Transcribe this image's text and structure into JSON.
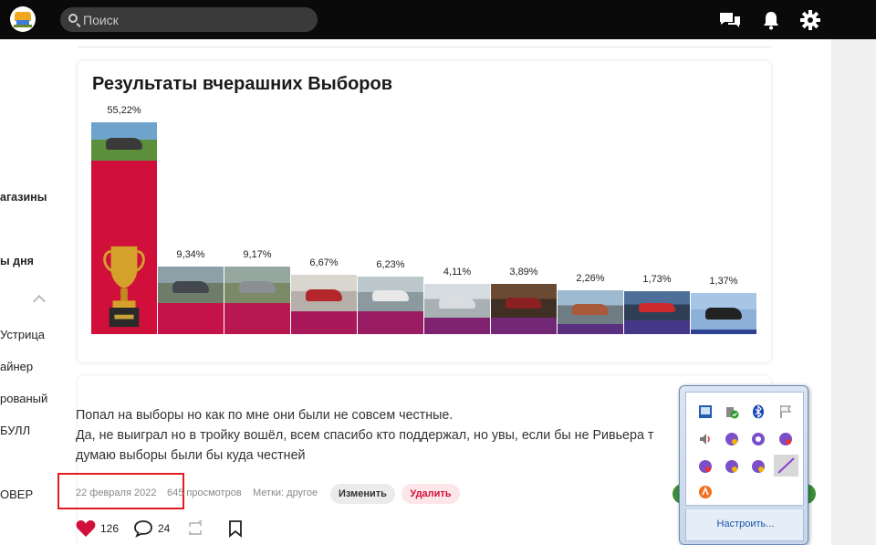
{
  "header": {
    "search_placeholder": "Поиск"
  },
  "sidebar": {
    "items": [
      "агазины",
      "ы дня",
      "Устрица",
      "айнер",
      "рованый",
      "БУЛЛ",
      "ОВЕР"
    ]
  },
  "results": {
    "title": "Результаты вчерашних Выборов",
    "bars": [
      {
        "pct": "55,22%",
        "value": 55.22,
        "color": "#d0103a"
      },
      {
        "pct": "9,34%",
        "value": 9.34,
        "color": "#c4134a"
      },
      {
        "pct": "9,17%",
        "value": 9.17,
        "color": "#b8174f"
      },
      {
        "pct": "6,67%",
        "value": 6.67,
        "color": "#a9195a"
      },
      {
        "pct": "6,23%",
        "value": 6.23,
        "color": "#9a1c62"
      },
      {
        "pct": "4,11%",
        "value": 4.11,
        "color": "#7f2270"
      },
      {
        "pct": "3,89%",
        "value": 3.89,
        "color": "#722876"
      },
      {
        "pct": "2,26%",
        "value": 2.26,
        "color": "#5a2f80"
      },
      {
        "pct": "1,73%",
        "value": 1.73,
        "color": "#443788"
      },
      {
        "pct": "1,37%",
        "value": 1.37,
        "color": "#2f4290"
      }
    ]
  },
  "post": {
    "lines": [
      "Попал на выборы но как по мне они были не совсем честные.",
      "Да, не выиграл но в тройку вошёл, всем спасибо кто поддержал, но увы, если бы не Ривьера т",
      "думаю выборы были бы куда честней"
    ],
    "date": "22 февраля 2022",
    "views": "645 просмотров",
    "tags": "Метки: другое",
    "edit_label": "Изменить",
    "delete_label": "Удалить",
    "likes": "126",
    "comments": "24"
  },
  "tray": {
    "customize_label": "Настроить..."
  },
  "colors": {
    "topbar": "#0a0a0a",
    "like_red": "#d0103a",
    "highlight_box": "#e41b1b"
  }
}
